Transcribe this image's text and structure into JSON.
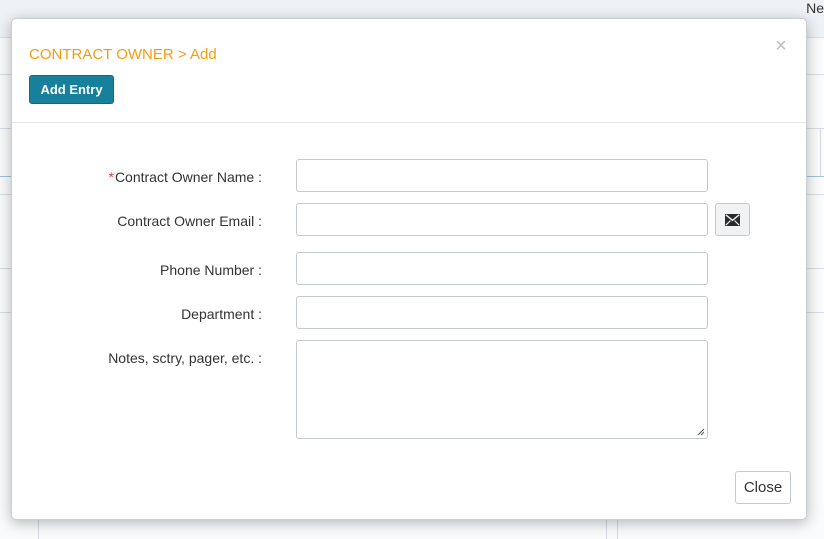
{
  "background": {
    "topbar_text": "Ne"
  },
  "modal": {
    "title": "CONTRACT OWNER > Add",
    "close_symbol": "×",
    "add_entry_label": "Add Entry",
    "fields": {
      "owner_name": {
        "required_mark": "*",
        "label": "Contract Owner Name :",
        "value": ""
      },
      "owner_email": {
        "label": "Contract Owner Email :",
        "value": "",
        "button_icon": "envelope-icon"
      },
      "phone": {
        "label": "Phone Number :",
        "value": ""
      },
      "department": {
        "label": "Department :",
        "value": ""
      },
      "notes": {
        "label": "Notes, sctry, pager, etc. :",
        "value": ""
      }
    },
    "close_label": "Close"
  },
  "colors": {
    "title": "#f39c12",
    "primary_button": "#17809a",
    "required": "#e53935"
  }
}
